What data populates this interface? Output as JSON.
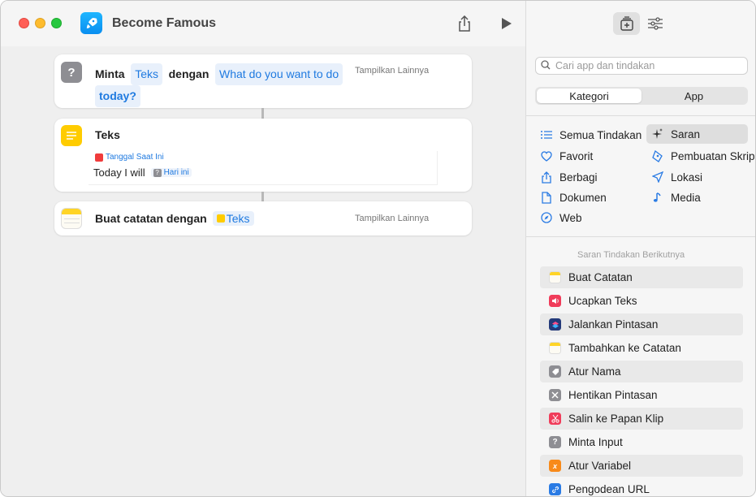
{
  "window": {
    "title": "Become Famous"
  },
  "colors": {
    "accent": "#1f7ae0",
    "chip_bg": "#e8f0fb"
  },
  "actions_flow": [
    {
      "icon": "question-mark-icon",
      "label": "Minta",
      "param1": "Teks",
      "connector_word": "dengan",
      "param2_line1": "What do you want to do",
      "param2_line2": "today?",
      "show_more": "Tampilkan Lainnya"
    },
    {
      "icon": "text-icon",
      "label": "Teks",
      "variable_chip": "Tanggal Saat Ini",
      "text_body": "Today I will",
      "inline_chip": "Hari ini"
    },
    {
      "icon": "notes-icon",
      "label": "Buat catatan dengan",
      "param1": "Teks",
      "show_more": "Tampilkan Lainnya"
    }
  ],
  "sidebar": {
    "search_placeholder": "Cari app dan tindakan",
    "segments": [
      "Kategori",
      "App"
    ],
    "categories_left": [
      "Semua Tindakan",
      "Favorit",
      "Berbagi",
      "Dokumen",
      "Web"
    ],
    "categories_right": [
      "Saran",
      "Pembuatan Skrip",
      "Lokasi",
      "Media"
    ],
    "selected_category": "Saran",
    "section_title": "Saran Tindakan Berikutnya",
    "suggestions": [
      {
        "label": "Buat Catatan",
        "icon": "notes-icon",
        "color": "#f4f0e0"
      },
      {
        "label": "Ucapkan Teks",
        "icon": "speaker-icon",
        "color": "#f03c5a"
      },
      {
        "label": "Jalankan Pintasan",
        "icon": "shortcuts-icon",
        "color": "#243a7a"
      },
      {
        "label": "Tambahkan ke Catatan",
        "icon": "notes-icon",
        "color": "#f4f0e0"
      },
      {
        "label": "Atur Nama",
        "icon": "tag-icon",
        "color": "#8e8e93"
      },
      {
        "label": "Hentikan Pintasan",
        "icon": "x-icon",
        "color": "#8e8e93"
      },
      {
        "label": "Salin ke Papan Klip",
        "icon": "scissors-icon",
        "color": "#f03c5a"
      },
      {
        "label": "Minta Input",
        "icon": "question-mark-icon",
        "color": "#8e8e93"
      },
      {
        "label": "Atur Variabel",
        "icon": "variable-icon",
        "color": "#f88a1a"
      },
      {
        "label": "Pengodean URL",
        "icon": "link-icon",
        "color": "#2a7be4"
      }
    ]
  }
}
